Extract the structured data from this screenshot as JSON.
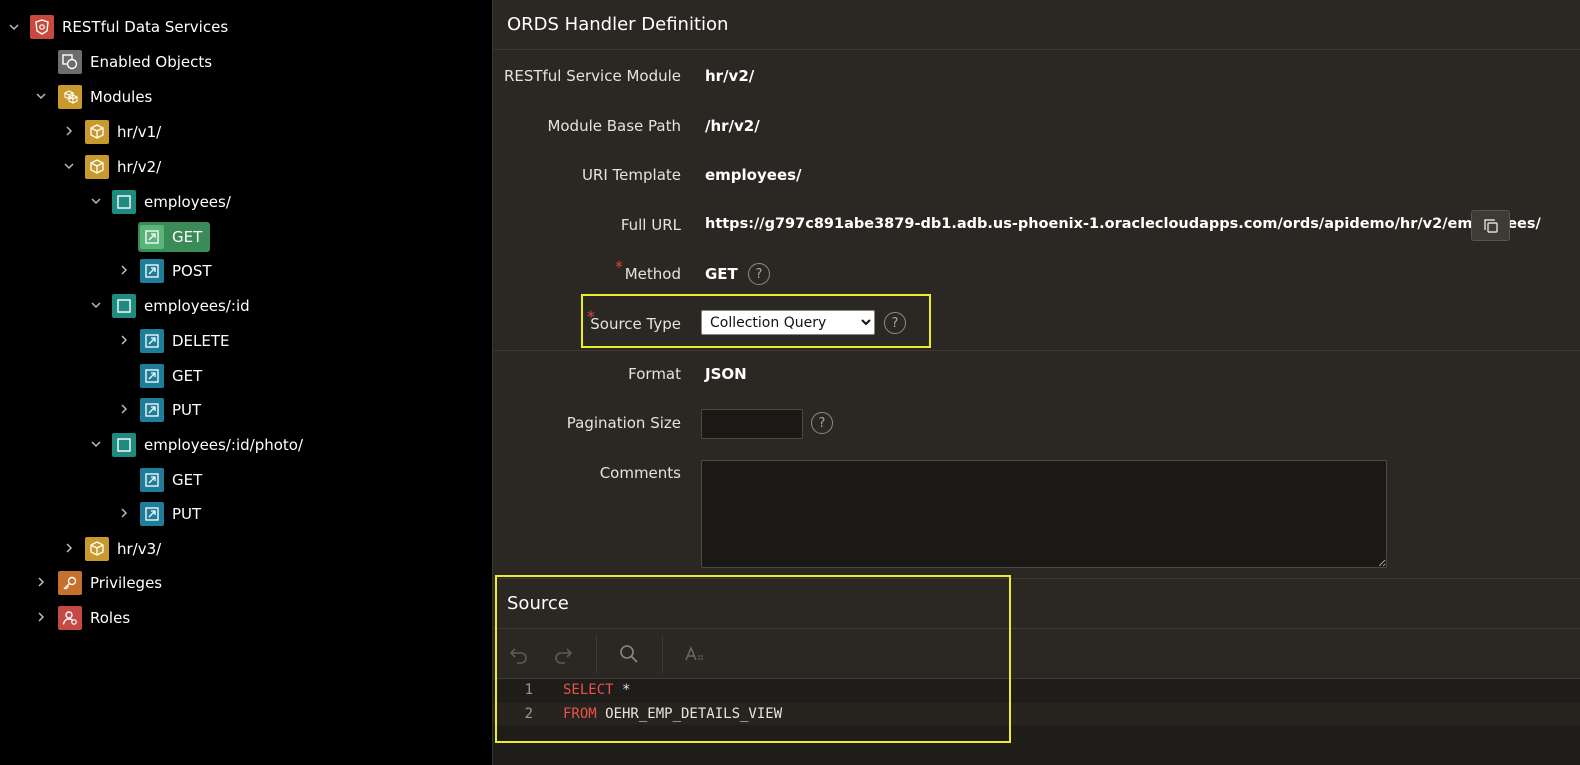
{
  "tree": {
    "root": {
      "label": "RESTful Data Services",
      "icon": "rest-shield-icon"
    },
    "enabled_objects": {
      "label": "Enabled Objects",
      "icon": "enabled-objects-icon"
    },
    "modules": {
      "label": "Modules",
      "icon": "modules-icon"
    },
    "hr_v1": {
      "label": "hr/v1/"
    },
    "hr_v2": {
      "label": "hr/v2/"
    },
    "employees": {
      "label": "employees/"
    },
    "employees_get": {
      "label": "GET"
    },
    "employees_post": {
      "label": "POST"
    },
    "employees_id": {
      "label": "employees/:id"
    },
    "employees_id_delete": {
      "label": "DELETE"
    },
    "employees_id_get": {
      "label": "GET"
    },
    "employees_id_put": {
      "label": "PUT"
    },
    "employees_id_photo": {
      "label": "employees/:id/photo/"
    },
    "photo_get": {
      "label": "GET"
    },
    "photo_put": {
      "label": "PUT"
    },
    "hr_v3": {
      "label": "hr/v3/"
    },
    "privileges": {
      "label": "Privileges"
    },
    "roles": {
      "label": "Roles"
    }
  },
  "handler": {
    "title": "ORDS Handler Definition",
    "fields": {
      "module": {
        "label": "RESTful Service Module",
        "value": "hr/v2/"
      },
      "base_path": {
        "label": "Module Base Path",
        "value": "/hr/v2/"
      },
      "uri_template": {
        "label": "URI Template",
        "value": "employees/"
      },
      "full_url": {
        "label": "Full URL",
        "value": "https://g797c891abe3879-db1.adb.us-phoenix-1.oraclecloudapps.com/ords/apidemo/hr/v2/employees/"
      },
      "method": {
        "label": "Method",
        "value": "GET"
      },
      "source_type": {
        "label": "Source Type",
        "value": "Collection Query"
      },
      "format": {
        "label": "Format",
        "value": "JSON"
      },
      "pagination_size": {
        "label": "Pagination Size",
        "value": ""
      },
      "comments": {
        "label": "Comments",
        "value": ""
      }
    },
    "required_mark": "*",
    "help_glyph": "?"
  },
  "source": {
    "title": "Source",
    "lines": [
      {
        "num": "1",
        "keyword": "SELECT",
        "rest": " *"
      },
      {
        "num": "2",
        "keyword": "FROM",
        "rest": " OEHR_EMP_DETAILS_VIEW"
      }
    ]
  },
  "colors": {
    "highlight": "#ecec2a",
    "selected": "#43a566",
    "keyword": "#e8524a"
  }
}
